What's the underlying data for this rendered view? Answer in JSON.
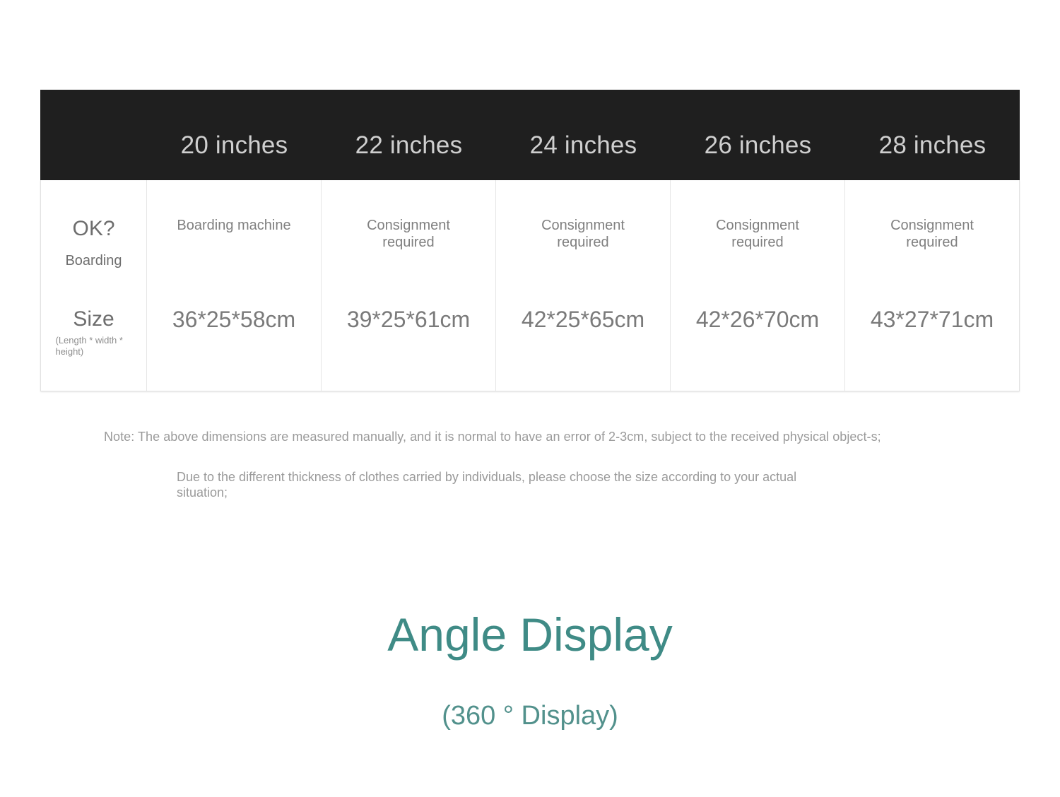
{
  "table": {
    "header": {
      "corner_label": "",
      "columns": [
        "20 inches",
        "22 inches",
        "24 inches",
        "26 inches",
        "28 inches"
      ]
    },
    "rows": [
      {
        "label": "OK?",
        "sub_label": "Boarding",
        "sub_label_2": "",
        "values": [
          "Boarding machine",
          "Consignment required",
          "Consignment required",
          "Consignment required",
          "Consignment required"
        ]
      },
      {
        "label": "Size",
        "sub_label": "(Length * width * height)",
        "sub_label_2": "",
        "values": [
          "36*25*58cm",
          "39*25*61cm",
          "42*25*65cm",
          "42*26*70cm",
          "43*27*71cm"
        ]
      }
    ]
  },
  "notes": {
    "line1": "Note: The above dimensions are measured manually, and it is normal to have an error of 2-3cm, subject to the received physical object-s;",
    "line2": "Due to the different thickness of clothes carried by individuals, please choose the size according to your actual situation;"
  },
  "angle_section": {
    "title": "Angle Display",
    "subtitle": "(360 ° Display)"
  },
  "colors": {
    "header_bar": "#1f1f1f",
    "header_text": "#cfcfcf",
    "body_text": "#7a7a7a",
    "note_text": "#9a9a9a",
    "accent_teal": "#3f8b86",
    "accent_teal_light": "#52918c",
    "page_background": "#ffffff"
  }
}
